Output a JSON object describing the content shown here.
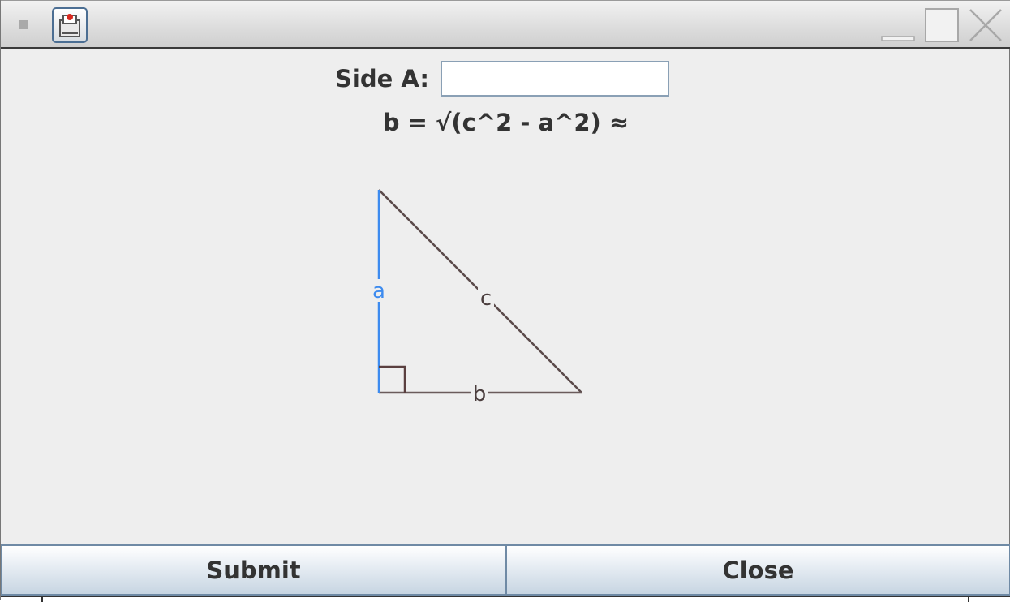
{
  "window": {
    "title": "",
    "controls": {
      "menu_icon": "window-menu-icon",
      "app_icon": "app-icon",
      "minimize_icon": "minimize-icon",
      "maximize_icon": "maximize-icon",
      "close_icon": "close-icon"
    }
  },
  "form": {
    "side_a_label": "Side A:",
    "side_a_value": "",
    "formula": "b = √(c^2 - a^2) ≈"
  },
  "diagram": {
    "label_a": "a",
    "label_b": "b",
    "label_c": "c",
    "colors": {
      "side_a": "#3d8bef",
      "side_b": "#6a5b5b",
      "side_c": "#5b4a4a",
      "right_angle": "#5a3f3f"
    }
  },
  "buttons": {
    "submit_label": "Submit",
    "close_label": "Close"
  }
}
